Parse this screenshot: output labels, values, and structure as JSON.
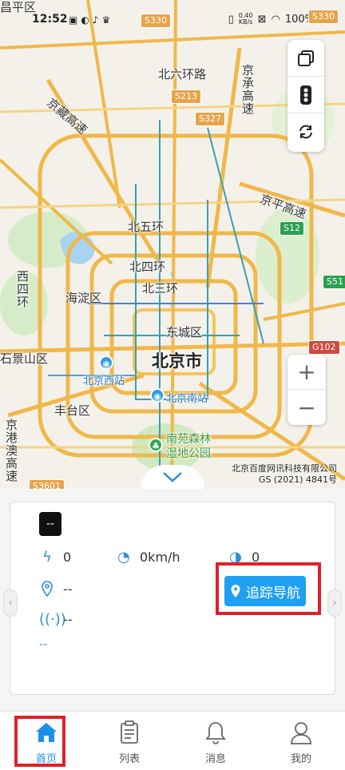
{
  "status_bar": {
    "time": "12:52",
    "net_speed_value": "0.40",
    "net_speed_unit": "KB/s",
    "battery": "100%"
  },
  "map": {
    "labels": {
      "changping": "昌平区",
      "beiliuhuan": "北六环路",
      "jingcheng": "京承高速",
      "jingzang": "京藏高速",
      "jingping": "京平高速",
      "beiwuhuan": "北五环",
      "beisihuan": "北四环",
      "beisanhuan": "北三环",
      "haidian": "海淀区",
      "xisihuan": "西四环",
      "dongcheng": "东城区",
      "beijing": "北京市",
      "shijingshan": "石景山区",
      "beijingxi": "北京西站",
      "beijingnan": "北京南站",
      "fengtai": "丰台区",
      "jinggangao": "京港澳高速",
      "nanyuan": "南苑森林湿地公园"
    },
    "shields": {
      "s330a": "S330",
      "s330b": "S330",
      "s213": "S213",
      "s327": "S327",
      "s12": "S12",
      "s51": "S51",
      "g102": "G102",
      "s3601": "S3601"
    },
    "copyright_line1": "北京百度网讯科技有限公司",
    "copyright_line2": "GS (2021) 4841号",
    "zoom_in": "+",
    "zoom_out": "−"
  },
  "card": {
    "plate": "--",
    "voltage": "0",
    "speed": "0km/h",
    "mileage": "0",
    "location": "--",
    "signal": "--",
    "link": "--",
    "nav_button": "追踪导航"
  },
  "tabs": [
    {
      "label": "首页"
    },
    {
      "label": "列表"
    },
    {
      "label": "消息"
    },
    {
      "label": "我的"
    }
  ],
  "colors": {
    "accent": "#1e9ff2",
    "highlight": "#e0202c"
  }
}
